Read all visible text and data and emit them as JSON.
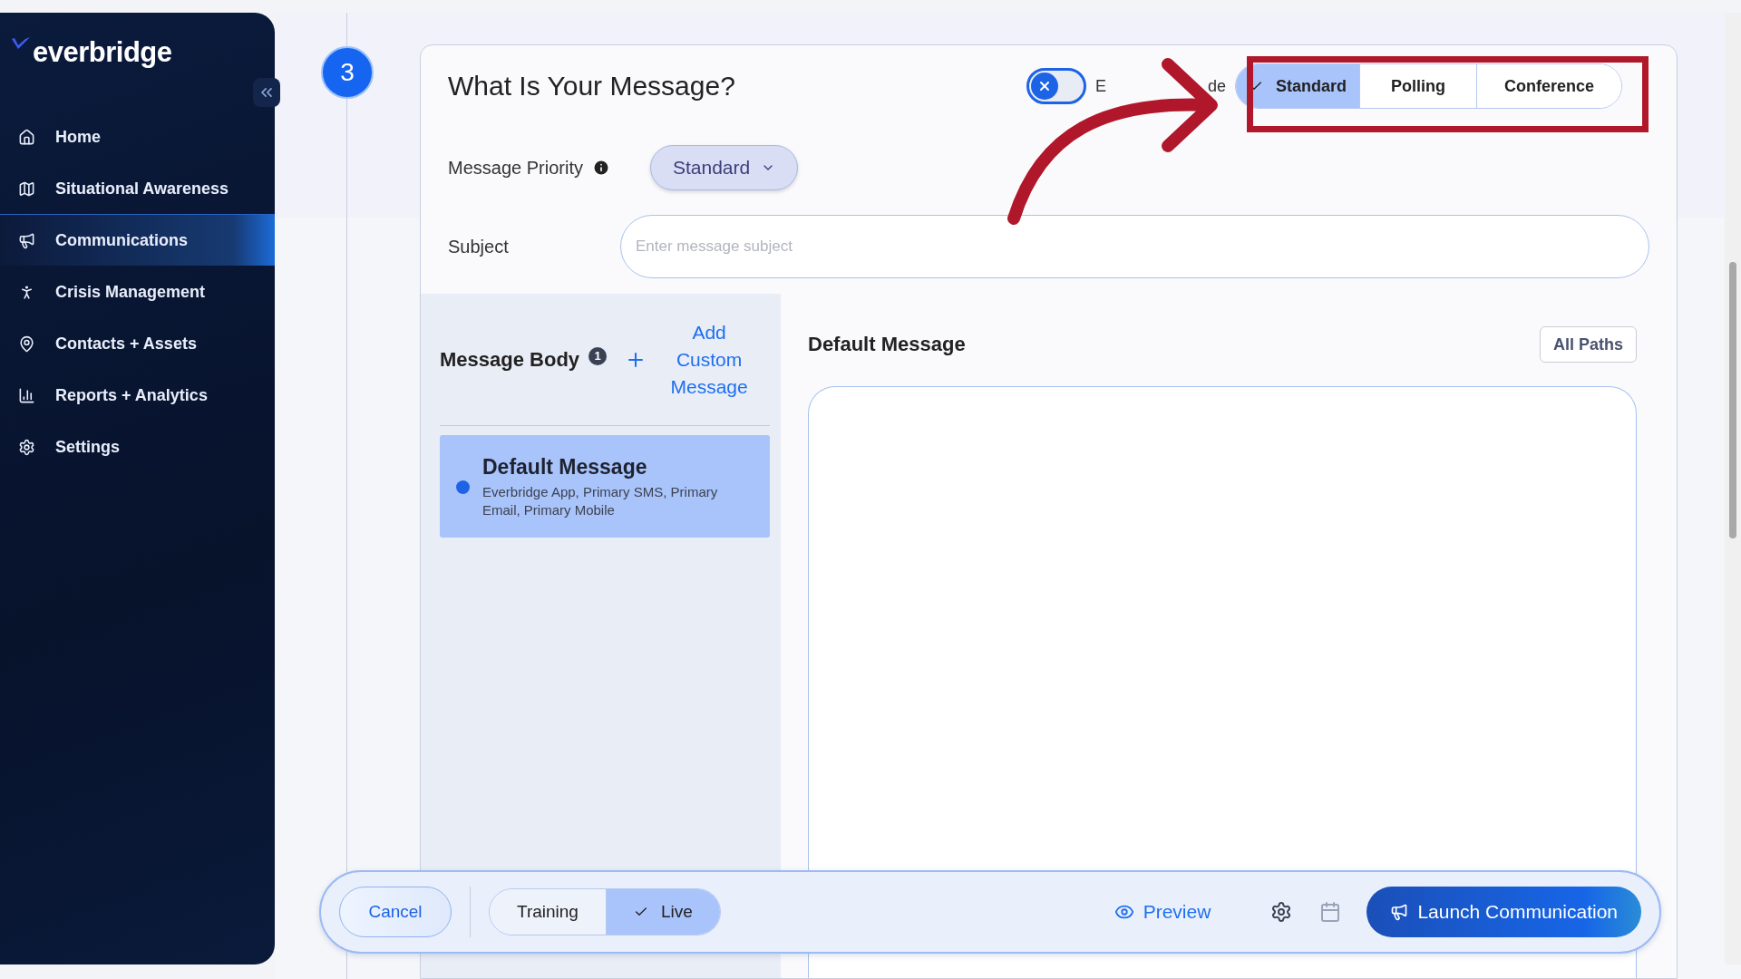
{
  "sidebar": {
    "logo": "everbridge",
    "items": [
      {
        "label": "Home",
        "selected": false
      },
      {
        "label": "Situational Awareness",
        "selected": false
      },
      {
        "label": "Communications",
        "selected": true
      },
      {
        "label": "Crisis Management",
        "selected": false
      },
      {
        "label": "Contacts + Assets",
        "selected": false
      },
      {
        "label": "Reports + Analytics",
        "selected": false
      },
      {
        "label": "Settings",
        "selected": false
      }
    ]
  },
  "step": "3",
  "card": {
    "title": "What Is Your Message?",
    "toggle": {
      "on": false,
      "label_start": "E",
      "label_end": "de"
    },
    "message_types": [
      {
        "label": "Standard",
        "selected": true
      },
      {
        "label": "Polling",
        "selected": false
      },
      {
        "label": "Conference",
        "selected": false
      }
    ],
    "priority": {
      "label": "Message Priority",
      "value": "Standard"
    },
    "subject": {
      "label": "Subject",
      "placeholder": "Enter message subject"
    },
    "message_body": {
      "title": "Message Body",
      "info_badge": "1",
      "add_link": "Add Custom Message",
      "messages": [
        {
          "title": "Default Message",
          "paths": "Everbridge App, Primary SMS, Primary Email, Primary Mobile",
          "selected": true
        }
      ]
    },
    "editor": {
      "title": "Default Message",
      "paths_button": "All Paths"
    }
  },
  "footer": {
    "cancel": "Cancel",
    "modes": [
      {
        "label": "Training",
        "selected": false
      },
      {
        "label": "Live",
        "selected": true
      }
    ],
    "preview": "Preview",
    "launch": "Launch Communication"
  }
}
